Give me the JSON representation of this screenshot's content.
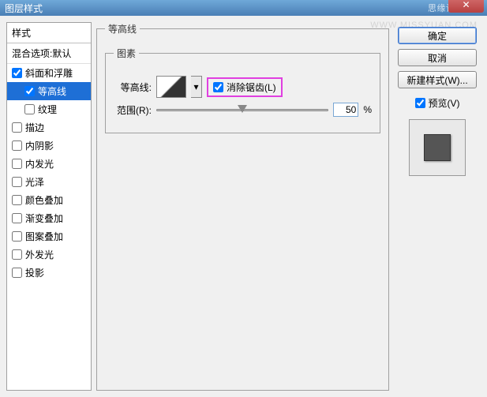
{
  "title": "图层样式",
  "watermark_title": "思缘设计论坛",
  "watermark_url": "WWW.MISSYUAN.COM",
  "close_glyph": "✕",
  "left": {
    "header": "样式",
    "sub": "混合选项:默认",
    "items": [
      {
        "label": "斜面和浮雕",
        "checked": true,
        "indent": false,
        "selected": false
      },
      {
        "label": "等高线",
        "checked": true,
        "indent": true,
        "selected": true
      },
      {
        "label": "纹理",
        "checked": false,
        "indent": true,
        "selected": false
      },
      {
        "label": "描边",
        "checked": false,
        "indent": false,
        "selected": false
      },
      {
        "label": "内阴影",
        "checked": false,
        "indent": false,
        "selected": false
      },
      {
        "label": "内发光",
        "checked": false,
        "indent": false,
        "selected": false
      },
      {
        "label": "光泽",
        "checked": false,
        "indent": false,
        "selected": false
      },
      {
        "label": "颜色叠加",
        "checked": false,
        "indent": false,
        "selected": false
      },
      {
        "label": "渐变叠加",
        "checked": false,
        "indent": false,
        "selected": false
      },
      {
        "label": "图案叠加",
        "checked": false,
        "indent": false,
        "selected": false
      },
      {
        "label": "外发光",
        "checked": false,
        "indent": false,
        "selected": false
      },
      {
        "label": "投影",
        "checked": false,
        "indent": false,
        "selected": false
      }
    ]
  },
  "mid": {
    "outer_legend": "等高线",
    "inner_legend": "图素",
    "contour_label": "等高线:",
    "dd_glyph": "▾",
    "antialias_label": "消除锯齿(L)",
    "antialias_checked": true,
    "range_label": "范围(R):",
    "range_value": "50",
    "range_unit": "%"
  },
  "right": {
    "ok": "确定",
    "cancel": "取消",
    "newstyle": "新建样式(W)...",
    "preview_label": "预览(V)",
    "preview_checked": true
  }
}
